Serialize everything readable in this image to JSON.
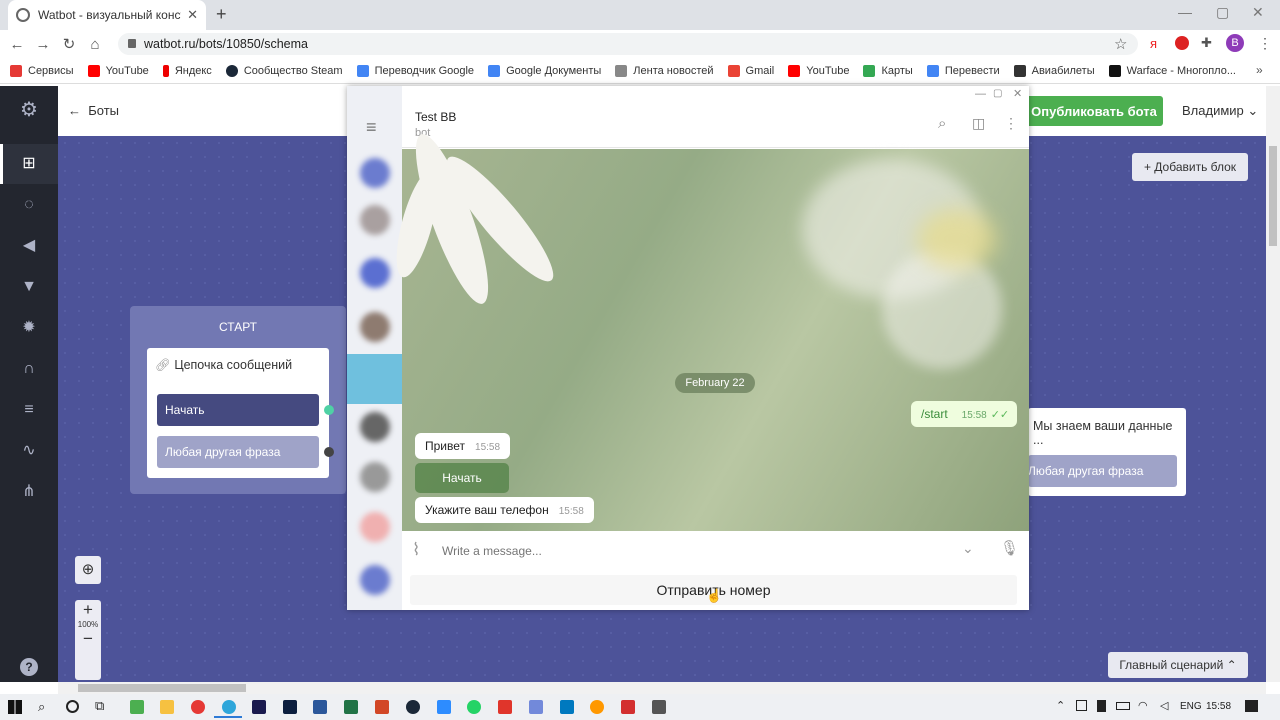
{
  "browser": {
    "tab_title": "Watbot - визуальный конструкт",
    "url": "watbot.ru/bots/10850/schema",
    "bookmarks": [
      "Сервисы",
      "YouTube",
      "Яндекс",
      "Сообщество Steam",
      "Переводчик Google",
      "Google Документы",
      "Лента новостей",
      "Gmail",
      "YouTube",
      "Карты",
      "Перевести",
      "Авиабилеты",
      "Warface - Многопло..."
    ]
  },
  "app": {
    "back_label": "Боты",
    "publish_label": "Опубликовать бота",
    "user_name": "Владимир",
    "add_block_label": "Добавить блок",
    "start_label": "СТАРТ",
    "chain_title": "Цепочка сообщений",
    "chain_buttons": [
      "Начать",
      "Любая другая фраза"
    ],
    "right_block_title": "Мы знаем ваши данные ...",
    "right_block_button": "Любая другая фраза",
    "zoom_level": "100%",
    "main_scenario_label": "Главный сценарий"
  },
  "telegram": {
    "chat_name": "Test BB",
    "chat_status": "bot",
    "date_pill": "February 22",
    "outgoing": {
      "text": "/start",
      "time": "15:58"
    },
    "incoming": [
      {
        "text": "Привет",
        "time": "15:58"
      },
      {
        "text": "Укажите ваш телефон",
        "time": "15:58"
      }
    ],
    "inline_button": "Начать",
    "composer_placeholder": "Write a message...",
    "keyboard_button": "Отправить номер"
  },
  "taskbar": {
    "lang": "ENG",
    "time": "15:58"
  },
  "colors": {
    "canvas": "#4d5399",
    "publish": "#4caf50",
    "sidebar": "#23262f"
  }
}
